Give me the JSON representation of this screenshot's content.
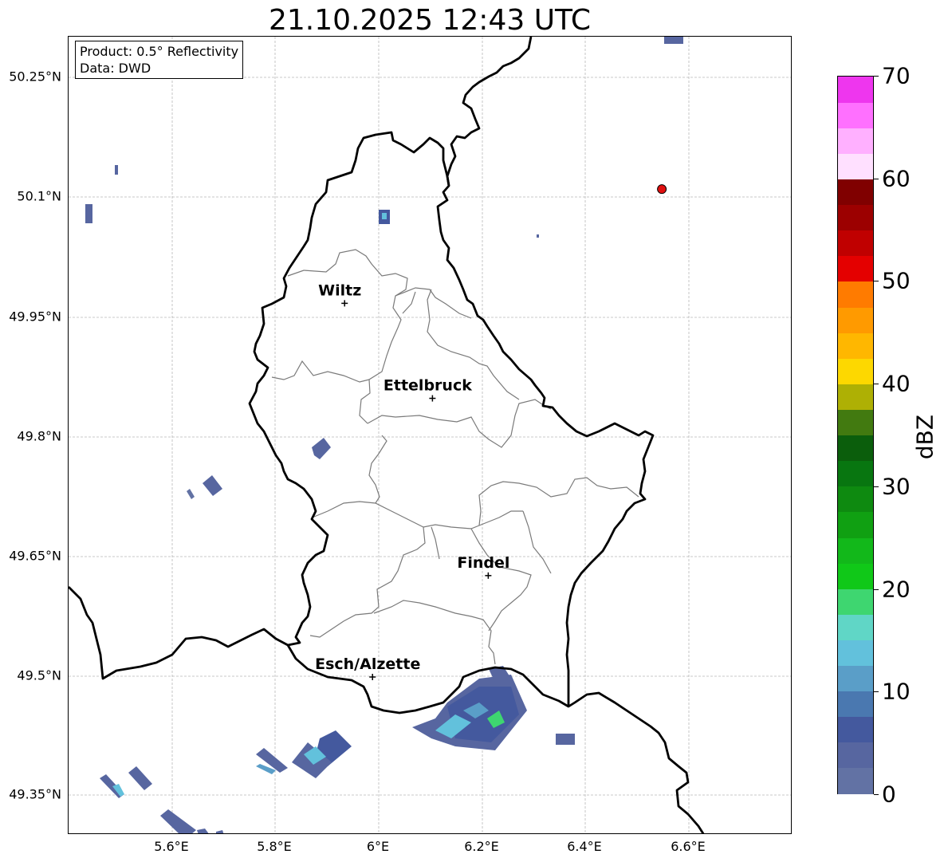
{
  "title": "21.10.2025 12:43 UTC",
  "info": {
    "product": "Product: 0.5° Reflectivity",
    "data": "Data: DWD"
  },
  "lat_ticks": [
    "50.25°N",
    "50.1°N",
    "49.95°N",
    "49.8°N",
    "49.65°N",
    "49.5°N",
    "49.35°N"
  ],
  "lon_ticks": [
    "5.6°E",
    "5.8°E",
    "6°E",
    "6.2°E",
    "6.4°E",
    "6.6°E"
  ],
  "cities": [
    {
      "name": "Wiltz",
      "lon": 5.934,
      "lat": 49.967
    },
    {
      "name": "Ettelbruck",
      "lon": 6.104,
      "lat": 49.848
    },
    {
      "name": "Findel",
      "lon": 6.212,
      "lat": 49.626
    },
    {
      "name": "Esch/Alzette",
      "lon": 5.988,
      "lat": 49.499
    }
  ],
  "radar_site": {
    "lon": 6.548,
    "lat": 50.11,
    "color": "#e01010"
  },
  "colorbar": {
    "label": "dBZ",
    "min": 0,
    "max": 70,
    "step": 2.5,
    "tick_labels": [
      "0",
      "10",
      "20",
      "30",
      "40",
      "50",
      "60",
      "70"
    ],
    "colors": [
      "#6272a4",
      "#5766a0",
      "#44599e",
      "#4a78b0",
      "#5a9ec8",
      "#62c1dc",
      "#60d6c6",
      "#3ed670",
      "#10c818",
      "#12b81a",
      "#10a012",
      "#0e8a10",
      "#087610",
      "#0b5e0c",
      "#427a10",
      "#aeb004",
      "#fdd800",
      "#ffb700",
      "#ff9a00",
      "#ff7b00",
      "#e40000",
      "#c00000",
      "#9c0000",
      "#800000",
      "#ffe0ff",
      "#ffb0ff",
      "#ff70ff",
      "#ee36ee"
    ]
  }
}
